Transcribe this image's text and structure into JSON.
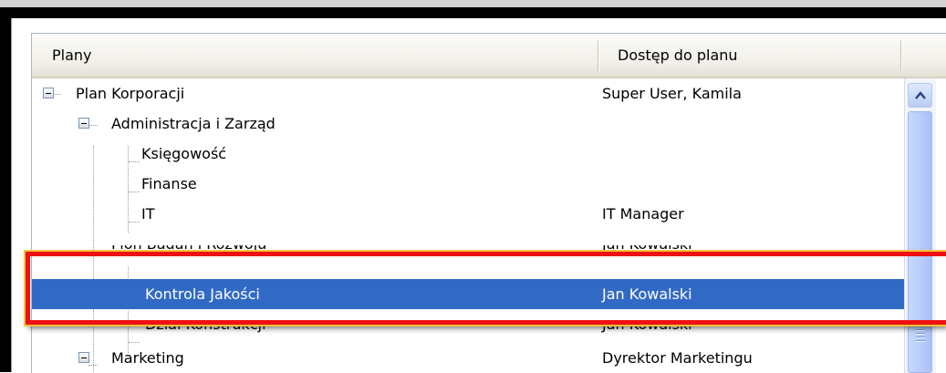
{
  "columns": {
    "plans": "Plany",
    "access": "Dostęp do planu"
  },
  "rows": [
    {
      "label": "Plan Korporacji",
      "access": "Super User, Kamila",
      "level": 0,
      "expanded": true
    },
    {
      "label": "Administracja i Zarząd",
      "access": "",
      "level": 1,
      "expanded": true
    },
    {
      "label": "Księgowość",
      "access": "",
      "level": 2
    },
    {
      "label": "Finanse",
      "access": "",
      "level": 2
    },
    {
      "label": "IT",
      "access": "IT Manager",
      "level": 2
    },
    {
      "label": "Pion Badań i Rozwoju",
      "access": "Jan Kowalski",
      "level": 1,
      "expanded": true,
      "partially_obscured": true
    },
    {
      "label": "Kontrola Jakości",
      "access": "Jan Kowalski",
      "level": 2,
      "selected": true
    },
    {
      "label": "Dział Konstrukcji",
      "access": "Jan Kowalski",
      "level": 2,
      "partially_obscured": true
    },
    {
      "label": "Marketing",
      "access": "Dyrektor Marketingu",
      "level": 1,
      "expanded": true
    }
  ],
  "icons": {
    "expander": "minus-box-icon",
    "scroll_up": "chevron-up-icon"
  },
  "colors": {
    "selection": "#316ac5",
    "highlight_border": "#ee1111",
    "highlight_outline": "#f5c23a"
  }
}
